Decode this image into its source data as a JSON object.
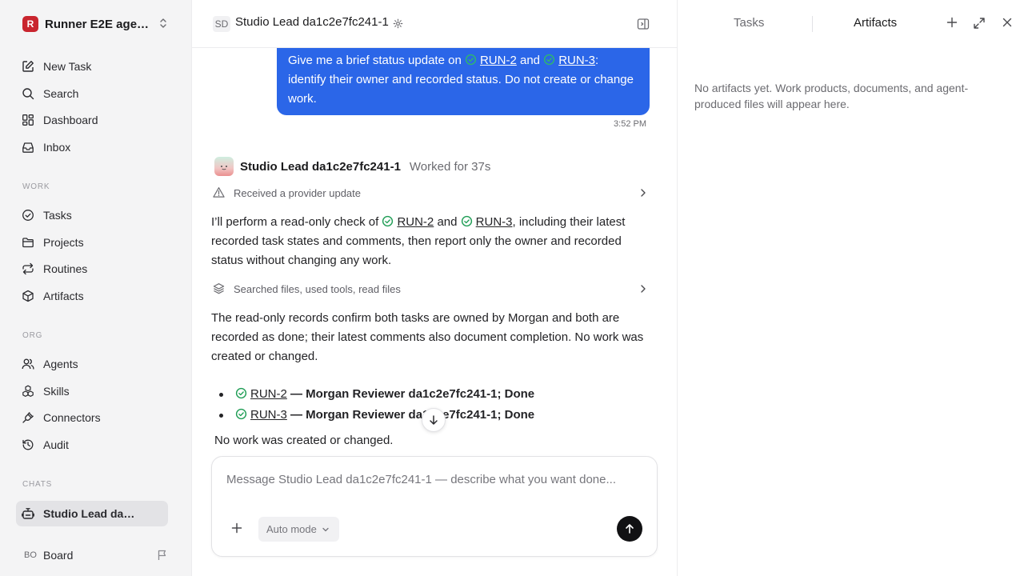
{
  "workspace": {
    "logo": "R",
    "name": "Runner E2E agen..."
  },
  "nav_main": [
    {
      "label": "New Task",
      "icon": "edit-icon"
    },
    {
      "label": "Search",
      "icon": "search-icon"
    },
    {
      "label": "Dashboard",
      "icon": "dashboard-icon"
    },
    {
      "label": "Inbox",
      "icon": "inbox-icon"
    }
  ],
  "sections": {
    "work": "WORK",
    "org": "ORG",
    "chats": "CHATS"
  },
  "nav_work": [
    {
      "label": "Tasks",
      "icon": "check-circle-icon"
    },
    {
      "label": "Projects",
      "icon": "folder-icon"
    },
    {
      "label": "Routines",
      "icon": "repeat-icon"
    },
    {
      "label": "Artifacts",
      "icon": "box-icon"
    }
  ],
  "nav_org": [
    {
      "label": "Agents",
      "icon": "users-icon"
    },
    {
      "label": "Skills",
      "icon": "boxes-icon"
    },
    {
      "label": "Connectors",
      "icon": "plug-icon"
    },
    {
      "label": "Audit",
      "icon": "history-icon"
    }
  ],
  "chats": [
    {
      "label": "Studio Lead da1c2e7fc241-1",
      "icon": "bot-icon"
    }
  ],
  "board": {
    "initials": "BO",
    "label": "Board"
  },
  "header": {
    "initials": "SD",
    "title": "Studio Lead da1c2e7fc241-1"
  },
  "conversation": {
    "user": {
      "prefix": "Give me a brief status update on",
      "link1": "RUN-2",
      "and": "and",
      "link2": "RUN-3",
      "suffix": ": identify their owner and recorded status. Do not create or change work.",
      "time": "3:52 PM"
    },
    "agent": {
      "name": "Studio Lead da1c2e7fc241-1",
      "worked": "Worked for 37s",
      "event1": "Received a provider update",
      "p1_prefix": "I’ll perform a read-only check of",
      "p1_link1": "RUN-2",
      "p1_and": "and",
      "p1_link2": "RUN-3",
      "p1_suffix": ", including their latest recorded task states and comments, then report only the owner and recorded status without changing any work.",
      "event2": "Searched files, used tools, read files",
      "p2": "The read-only records confirm both tasks are owned by Morgan and both are recorded as done; their latest comments also document completion. No work was created or changed.",
      "bullets": [
        {
          "link": "RUN-2",
          "text": "— Morgan Reviewer da1c2e7fc241-1; Done"
        },
        {
          "link": "RUN-3",
          "text": "— Morgan Reviewer da1c2e7fc241-1; Done"
        }
      ],
      "final": "No work was created or changed."
    }
  },
  "composer": {
    "placeholder": "Message Studio Lead da1c2e7fc241-1 — describe what you want done...",
    "mode": "Auto mode"
  },
  "right_panel": {
    "tabs": [
      "Tasks",
      "Artifacts"
    ],
    "active_tab": "Artifacts",
    "empty": "No artifacts yet. Work products, documents, and agent-produced files will appear here."
  },
  "colors": {
    "accent": "#2b66e8",
    "success": "#1f9d55",
    "logo": "#c9252e"
  }
}
